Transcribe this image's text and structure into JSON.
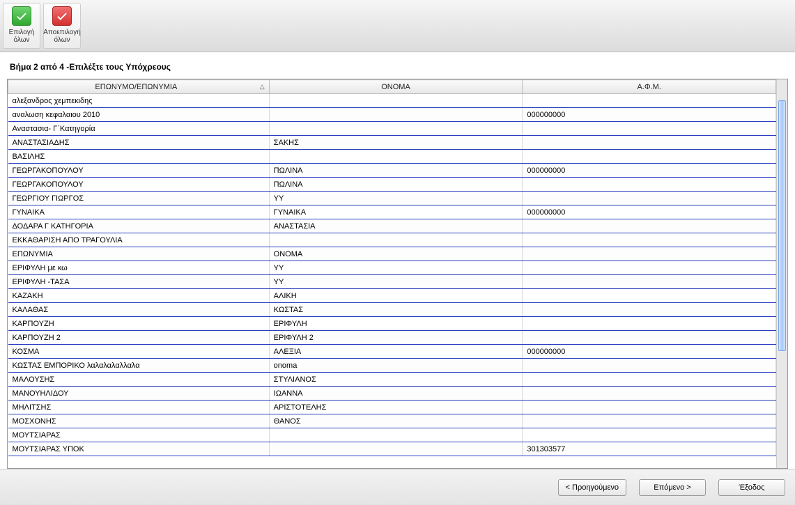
{
  "toolbar": {
    "select_all_label": "Επιλογή όλων",
    "deselect_all_label": "Αποεπιλογή όλων"
  },
  "step_title": "Βήμα 2 από 4 -Επιλέξτε τους Υπόχρεους",
  "columns": {
    "surname": "ΕΠΩΝΥΜΟ/ΕΠΩΝΥΜΙΑ",
    "name": "ΟΝΟΜΑ",
    "afm": "Α.Φ.Μ."
  },
  "sort_indicator": "△",
  "rows": [
    {
      "surname": "αλεξανδρος χεμπεκιδης",
      "name": "",
      "afm": ""
    },
    {
      "surname": "αναλωση κεφαλαιου 2010",
      "name": "",
      "afm": "000000000"
    },
    {
      "surname": "Αναστασια- Γ΄Κατηγορία",
      "name": "",
      "afm": ""
    },
    {
      "surname": "ΑΝΑΣΤΑΣΙΑΔΗΣ",
      "name": "ΣΑΚΗΣ",
      "afm": ""
    },
    {
      "surname": "ΒΑΣΙΛΗΣ",
      "name": "",
      "afm": ""
    },
    {
      "surname": "ΓΕΩΡΓΑΚΟΠΟΥΛΟΥ",
      "name": "ΠΩΛΙΝΑ",
      "afm": "000000000"
    },
    {
      "surname": "ΓΕΩΡΓΑΚΟΠΟΥΛΟΥ",
      "name": "ΠΩΛΙΝΑ",
      "afm": ""
    },
    {
      "surname": "ΓΕΩΡΓΙΟΥ ΓΙΩΡΓΟΣ",
      "name": "ΥΥ",
      "afm": ""
    },
    {
      "surname": "ΓΥΝΑΙΚΑ",
      "name": "ΓΥΝΑΙΚΑ",
      "afm": "000000000"
    },
    {
      "surname": "ΔΟΔΑΡΑ Γ ΚΑΤΗΓΟΡΙΑ",
      "name": "ΑΝΑΣΤΑΣΙΑ",
      "afm": ""
    },
    {
      "surname": "ΕΚΚΑΘΑΡΙΣΗ ΑΠΟ ΤΡΑΓΟΥΛΙΑ",
      "name": "",
      "afm": ""
    },
    {
      "surname": "ΕΠΩΝΥΜΙΑ",
      "name": "ΟΝΟΜΑ",
      "afm": ""
    },
    {
      "surname": "ΕΡΙΦΥΛΗ με κω",
      "name": "ΥΥ",
      "afm": ""
    },
    {
      "surname": "ΕΡΙΦΥΛΗ -ΤΑΣΑ",
      "name": "ΥΥ",
      "afm": ""
    },
    {
      "surname": "ΚΑΖΑΚΗ",
      "name": "ΑΛΙΚΗ",
      "afm": ""
    },
    {
      "surname": "ΚΑΛΑΘΑΣ",
      "name": "ΚΩΣΤΑΣ",
      "afm": ""
    },
    {
      "surname": "ΚΑΡΠΟΥΖΗ",
      "name": "ΕΡΙΦΥΛΗ",
      "afm": ""
    },
    {
      "surname": "ΚΑΡΠΟΥΖΗ  2",
      "name": "ΕΡΙΦΥΛΗ  2",
      "afm": ""
    },
    {
      "surname": "ΚΟΣΜΑ",
      "name": "ΑΛΕΞΙΑ",
      "afm": "000000000"
    },
    {
      "surname": "ΚΩΣΤΑΣ ΕΜΠΟΡΙΚΟ λαλαλαλαλλαλα",
      "name": "onoma",
      "afm": ""
    },
    {
      "surname": "ΜΑΛΟΥΣΗΣ",
      "name": "ΣΤΥΛΙΑΝΟΣ",
      "afm": ""
    },
    {
      "surname": "ΜΑΝΟΥΗΛΙΔΟΥ",
      "name": "ΙΩΑΝΝΑ",
      "afm": ""
    },
    {
      "surname": "ΜΗΛΙΤΣΗΣ",
      "name": "ΑΡΙΣΤΟΤΕΛΗΣ",
      "afm": ""
    },
    {
      "surname": "ΜΟΣΧΟΝΗΣ",
      "name": "ΘΑΝΟΣ",
      "afm": ""
    },
    {
      "surname": "ΜΟΥΤΣΙΑΡΑΣ",
      "name": "",
      "afm": ""
    },
    {
      "surname": "ΜΟΥΤΣΙΑΡΑΣ ΥΠΟΚ",
      "name": "",
      "afm": "301303577"
    }
  ],
  "footer": {
    "prev": "< Προηγούμενο",
    "next": "Επόμενο >",
    "exit": "Έξοδος"
  }
}
